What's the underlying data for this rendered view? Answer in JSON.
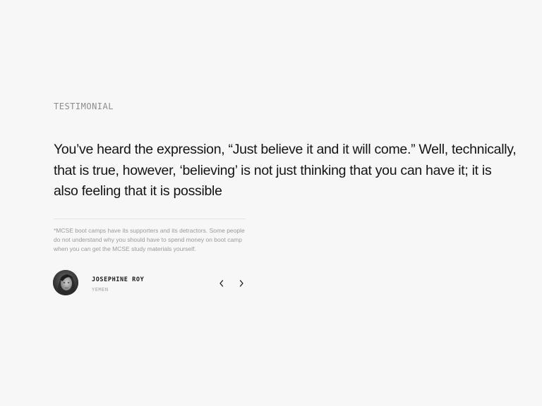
{
  "testimonial": {
    "eyebrow": "TESTIMONIAL",
    "quote": "You’ve heard the expression, “Just believe it and it will come.” Well, technically, that is true, however, ‘believing’ is not just thinking that you can have it; it is also feeling that it is possible",
    "note": "*MCSE boot camps have its supporters and its detractors. Some people do not understand why you should have to spend money on boot camp when you can get the MCSE study materials yourself.",
    "author": {
      "name": "JOSEPHINE ROY",
      "country": "YEMEN"
    },
    "nav": {
      "prev_icon": "chevron-left-icon",
      "next_icon": "chevron-right-icon"
    }
  },
  "colors": {
    "background": "#f7f7f7",
    "text": "#141414",
    "muted": "#9a9a9a"
  }
}
